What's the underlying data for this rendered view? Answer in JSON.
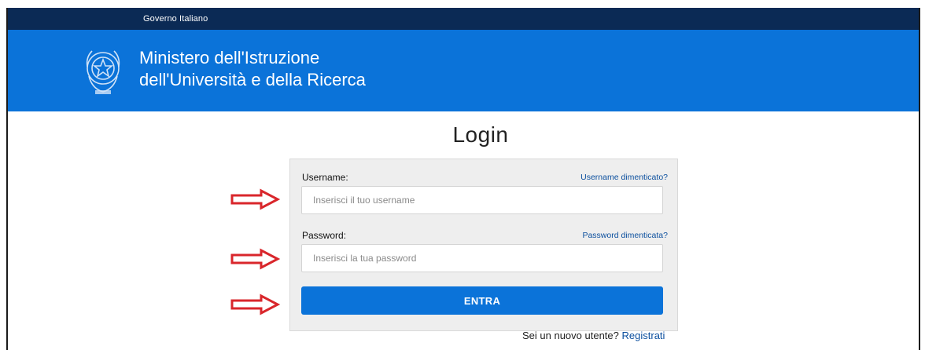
{
  "gov_bar": {
    "label": "Governo Italiano"
  },
  "header": {
    "emblem_icon": "italian-republic-emblem-icon",
    "title_line1": "Ministero dell'Istruzione",
    "title_line2": "dell'Università e della Ricerca"
  },
  "login": {
    "title": "Login",
    "username": {
      "label": "Username:",
      "forgot_link": "Username dimenticato?",
      "placeholder": "Inserisci il tuo username",
      "value": ""
    },
    "password": {
      "label": "Password:",
      "forgot_link": "Password dimenticata?",
      "placeholder": "Inserisci la tua password",
      "value": ""
    },
    "submit_label": "ENTRA"
  },
  "register": {
    "prompt": "Sei un nuovo utente?",
    "link": "Registrati"
  },
  "annotations": {
    "arrow_icon": "red-arrow-icon",
    "arrow_color": "#d9262b"
  },
  "colors": {
    "gov_bar": "#0b2a55",
    "header": "#0b73d9",
    "button": "#0b73d9",
    "link": "#0b4f9e"
  }
}
